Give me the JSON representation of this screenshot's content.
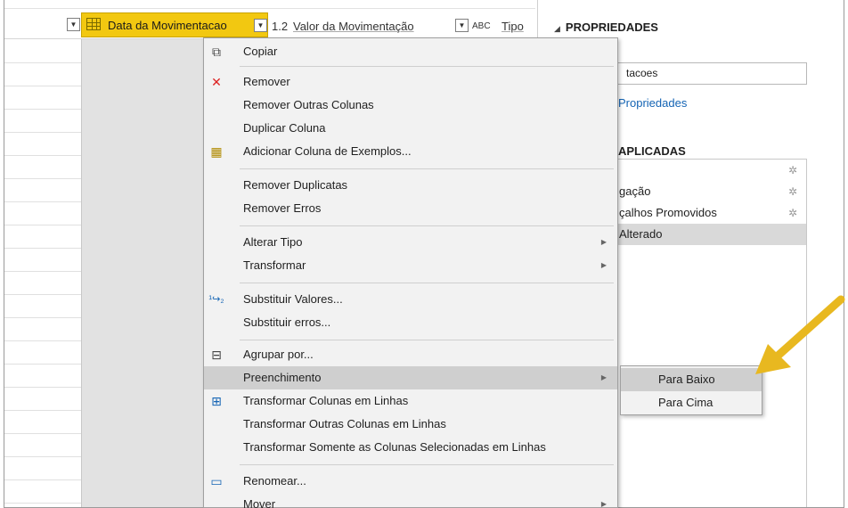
{
  "grid": {
    "selected_column": "Data da Movimentacao",
    "next_column": "Valor da Movimentação",
    "next_column_type": "1.2",
    "type_column_label": "Tipo",
    "type_column_icon": "ABC"
  },
  "pane": {
    "title": "PROPRIEDADES",
    "name_value": "tacoes",
    "all_properties_link": "Propriedades",
    "applied_steps_title": "APLICADAS",
    "steps": [
      {
        "label": "",
        "has_gear": true
      },
      {
        "label": "gação",
        "has_gear": true
      },
      {
        "label": "çalhos Promovidos",
        "has_gear": true
      },
      {
        "label": "Alterado",
        "has_gear": false,
        "selected": true
      }
    ]
  },
  "menu": {
    "items": [
      {
        "label": "Copiar",
        "icon": "copy-icon"
      },
      {
        "label": "Remover",
        "icon": "remove-icon"
      },
      {
        "label": "Remover Outras Colunas"
      },
      {
        "label": "Duplicar Coluna"
      },
      {
        "label": "Adicionar Coluna de Exemplos...",
        "icon": "add-example-icon"
      },
      {
        "label": "Remover Duplicatas"
      },
      {
        "label": "Remover Erros"
      },
      {
        "label": "Alterar Tipo",
        "submenu": true
      },
      {
        "label": "Transformar",
        "submenu": true
      },
      {
        "label": "Substituir Valores...",
        "icon": "replace-icon"
      },
      {
        "label": "Substituir erros..."
      },
      {
        "label": "Agrupar por...",
        "icon": "group-icon"
      },
      {
        "label": "Preenchimento",
        "submenu": true,
        "highlighted": true
      },
      {
        "label": "Transformar Colunas em Linhas",
        "icon": "unpivot-icon"
      },
      {
        "label": "Transformar Outras Colunas em Linhas"
      },
      {
        "label": "Transformar Somente as Colunas Selecionadas em Linhas"
      },
      {
        "label": "Renomear...",
        "icon": "rename-icon"
      },
      {
        "label": "Mover",
        "submenu": true
      }
    ]
  },
  "submenu": {
    "items": [
      {
        "label": "Para Baixo",
        "highlighted": true
      },
      {
        "label": "Para Cima"
      }
    ]
  },
  "colors": {
    "selected_header": "#f2c811",
    "teal_accent": "#1aa38c",
    "annotation_arrow": "#e8b820",
    "link": "#1464b4"
  }
}
